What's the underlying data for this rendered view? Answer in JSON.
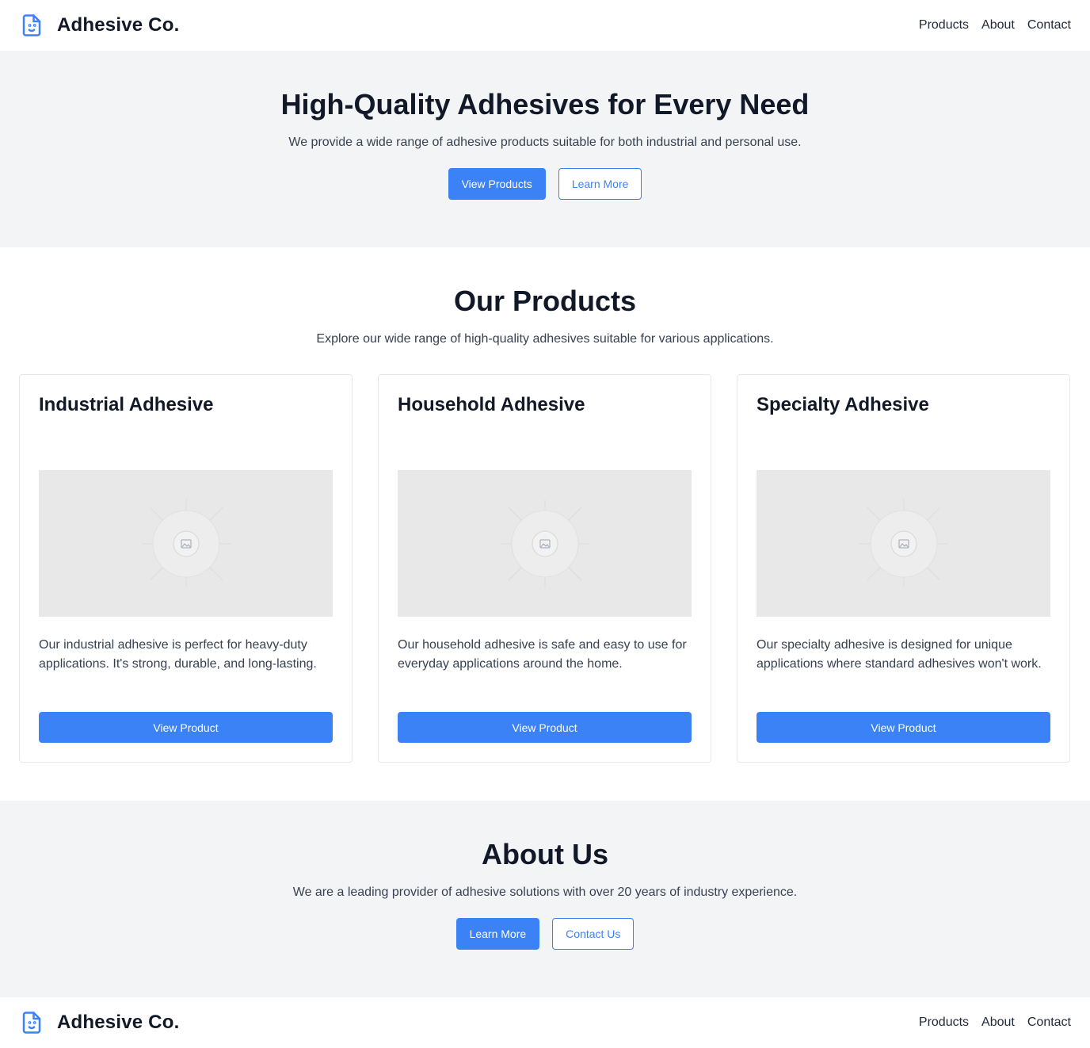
{
  "brand": {
    "name": "Adhesive Co.",
    "icon": "document-smile-icon"
  },
  "nav": [
    "Products",
    "About",
    "Contact"
  ],
  "hero": {
    "title": "High-Quality Adhesives for Every Need",
    "subtitle": "We provide a wide range of adhesive products suitable for both industrial and personal use.",
    "primary_button": "View Products",
    "secondary_button": "Learn More"
  },
  "products": {
    "title": "Our Products",
    "subtitle": "Explore our wide range of high-quality adhesives suitable for various applications.",
    "items": [
      {
        "name": "Industrial Adhesive",
        "description": "Our industrial adhesive is perfect for heavy-duty applications. It's strong, durable, and long-lasting.",
        "button": "View Product"
      },
      {
        "name": "Household Adhesive",
        "description": "Our household adhesive is safe and easy to use for everyday applications around the home.",
        "button": "View Product"
      },
      {
        "name": "Specialty Adhesive",
        "description": "Our specialty adhesive is designed for unique applications where standard adhesives won't work.",
        "button": "View Product"
      }
    ]
  },
  "about": {
    "title": "About Us",
    "subtitle": "We are a leading provider of adhesive solutions with over 20 years of industry experience.",
    "primary_button": "Learn More",
    "secondary_button": "Contact Us"
  },
  "colors": {
    "accent": "#3b82f6",
    "section_bg": "#f3f4f6",
    "text": "#111827"
  }
}
